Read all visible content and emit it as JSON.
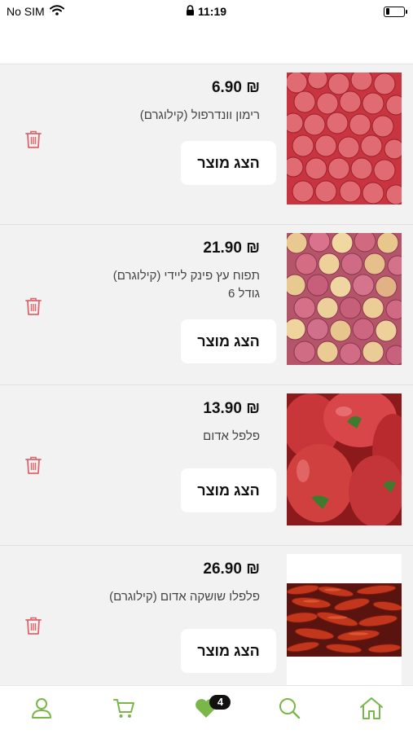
{
  "status_bar": {
    "carrier": "No SIM",
    "time": "11:19",
    "icons": [
      "wifi-icon",
      "lock-icon",
      "battery-icon"
    ]
  },
  "items": [
    {
      "price": "₪ 6.90",
      "title": "רימון וונדרפול (קילוגרם)",
      "button_label": "הצג מוצר",
      "image": "pomegranates"
    },
    {
      "price": "₪ 21.90",
      "title": "תפוח עץ פינק ליידי (קילוגרם) גודל 6",
      "button_label": "הצג מוצר",
      "image": "pink-apples"
    },
    {
      "price": "₪ 13.90",
      "title": "פלפל אדום",
      "button_label": "הצג מוצר",
      "image": "red-peppers"
    },
    {
      "price": "₪ 26.90",
      "title": "פלפלו שושקה אדום (קילוגרם)",
      "button_label": "הצג מוצר",
      "image": "shushka-peppers"
    }
  ],
  "bottom_nav": {
    "items": [
      "user-icon",
      "cart-icon",
      "heart-icon",
      "search-icon",
      "home-icon"
    ],
    "favorites_count": "4",
    "accent_color": "#7ab648"
  },
  "colors": {
    "trash": "#e0646a",
    "accent": "#7ab648"
  }
}
